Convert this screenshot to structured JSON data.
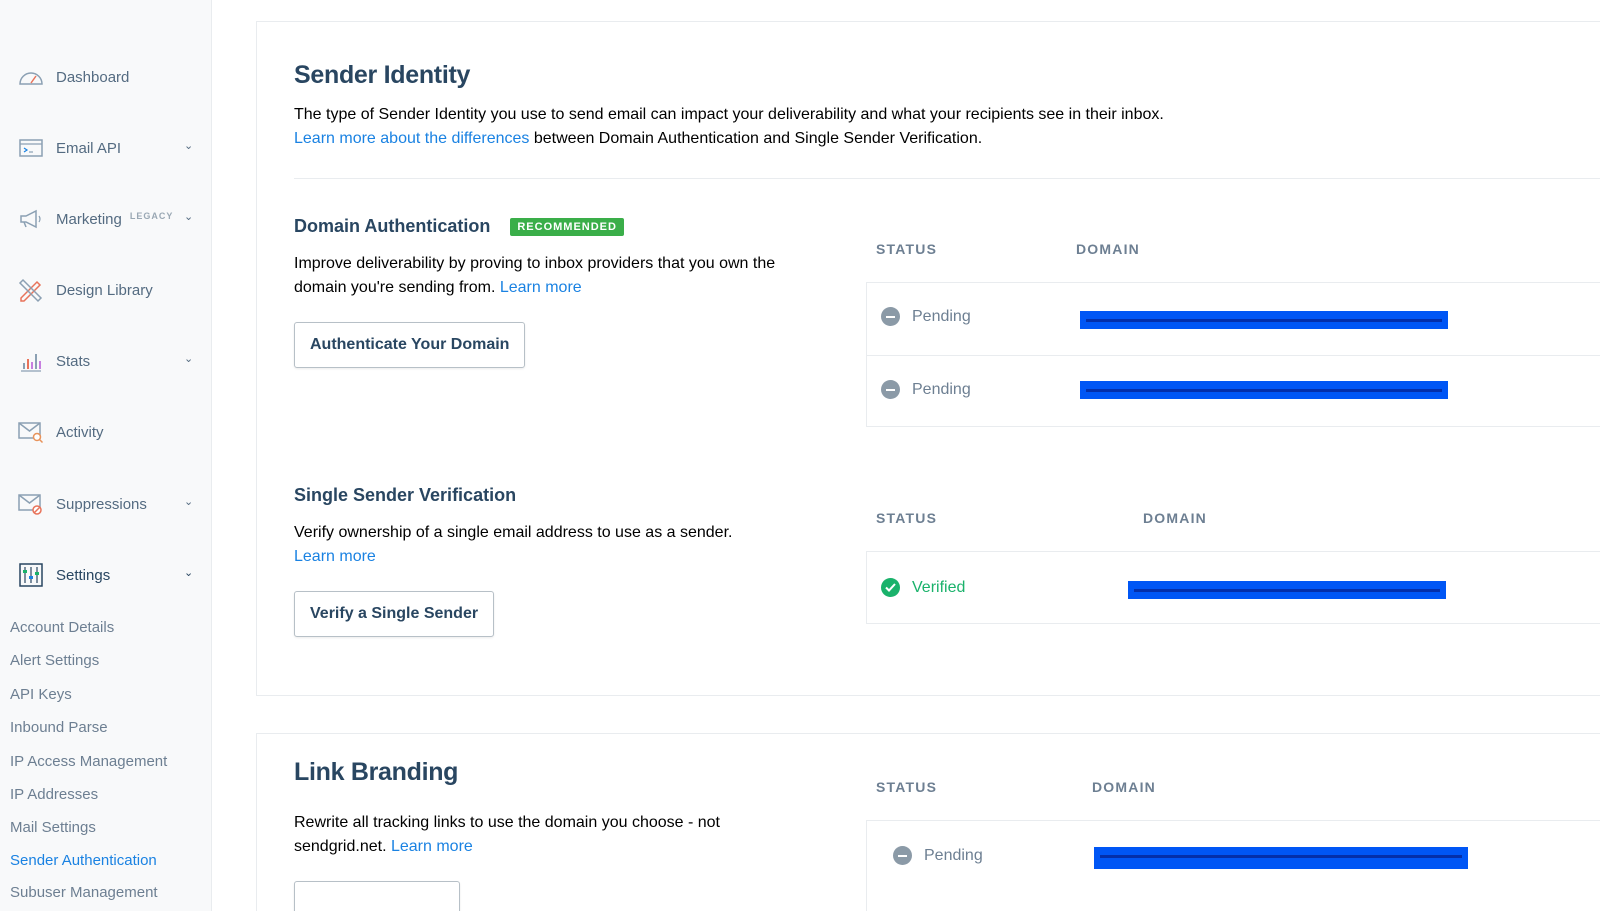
{
  "sidebar": {
    "items": [
      {
        "label": "Dashboard",
        "icon": "dashboard-gauge-icon",
        "tag": "",
        "chevron": false
      },
      {
        "label": "Email API",
        "icon": "email-api-terminal-icon",
        "tag": "",
        "chevron": true
      },
      {
        "label": "Marketing",
        "icon": "megaphone-icon",
        "tag": "LEGACY",
        "chevron": true
      },
      {
        "label": "Design Library",
        "icon": "design-pencil-ruler-icon",
        "tag": "",
        "chevron": false
      },
      {
        "label": "Stats",
        "icon": "stats-bar-icon",
        "tag": "",
        "chevron": true
      },
      {
        "label": "Activity",
        "icon": "activity-envelope-search-icon",
        "tag": "",
        "chevron": false
      },
      {
        "label": "Suppressions",
        "icon": "suppressions-envelope-block-icon",
        "tag": "",
        "chevron": true
      },
      {
        "label": "Settings",
        "icon": "settings-sliders-icon",
        "tag": "",
        "chevron": true
      }
    ],
    "settings_subnav": [
      "Account Details",
      "Alert Settings",
      "API Keys",
      "Inbound Parse",
      "IP Access Management",
      "IP Addresses",
      "Mail Settings",
      "Sender Authentication",
      "Subuser Management"
    ],
    "active_subnav": "Sender Authentication"
  },
  "sender_identity": {
    "title": "Sender Identity",
    "description": "The type of Sender Identity you use to send email can impact your deliverability and what your recipients see in their inbox.",
    "learn_link": "Learn more about the differences",
    "learn_suffix": " between Domain Authentication and Single Sender Verification."
  },
  "domain_auth": {
    "title": "Domain Authentication",
    "badge": "RECOMMENDED",
    "description": "Improve deliverability by proving to inbox providers that you own the domain you're sending from.",
    "learn_link": "Learn more",
    "button": "Authenticate Your Domain",
    "col_status": "STATUS",
    "col_domain": "DOMAIN",
    "rows": [
      {
        "status": "Pending"
      },
      {
        "status": "Pending"
      }
    ]
  },
  "single_sender": {
    "title": "Single Sender Verification",
    "description": "Verify ownership of a single email address to use as a sender.",
    "learn_link": "Learn more",
    "button": "Verify a Single Sender",
    "col_status": "STATUS",
    "col_domain": "DOMAIN",
    "rows": [
      {
        "status": "Verified"
      }
    ]
  },
  "link_branding": {
    "title": "Link Branding",
    "description": "Rewrite all tracking links to use the domain you choose - not sendgrid.net.",
    "learn_link": "Learn more",
    "col_status": "STATUS",
    "col_domain": "DOMAIN",
    "rows": [
      {
        "status": "Pending"
      }
    ]
  },
  "colors": {
    "link": "#1a82e2",
    "heading": "#294661",
    "badge": "#3aae49",
    "verified": "#1ab26b",
    "pending": "#8b9aa7",
    "redaction": "#0056f5"
  }
}
